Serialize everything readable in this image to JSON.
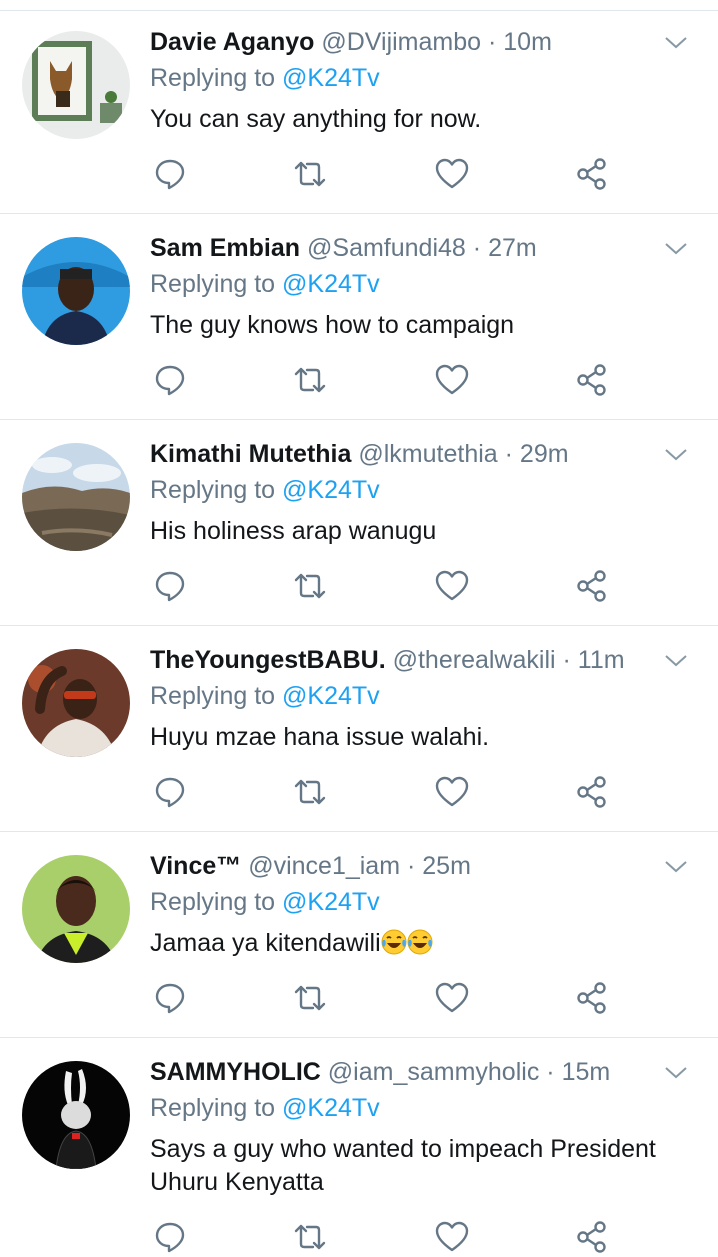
{
  "colors": {
    "name": "#14171a",
    "muted": "#657786",
    "link": "#1da1f2",
    "divider": "#e1e8ed"
  },
  "icons": [
    "reply-icon",
    "retweet-icon",
    "like-icon",
    "share-icon",
    "caret-down-icon"
  ],
  "tweets": [
    {
      "name": "Davie Aganyo",
      "handle": "@DVijimambo",
      "sep": "·",
      "time": "10m",
      "reply_prefix": "Replying to",
      "reply_to": "@K24Tv",
      "text": "You can say anything  for now."
    },
    {
      "name": "Sam Embian",
      "handle": "@Samfundi48",
      "sep": "·",
      "time": "27m",
      "reply_prefix": "Replying to",
      "reply_to": "@K24Tv",
      "text": "The guy knows how to campaign"
    },
    {
      "name": "Kimathi Mutethia",
      "handle": "@lkmutethia",
      "sep": "·",
      "time": "29m",
      "reply_prefix": "Replying to",
      "reply_to": "@K24Tv",
      "text": "His holiness arap wanugu"
    },
    {
      "name": "TheYoungestBABU.",
      "handle": "@therealwakili",
      "sep": "·",
      "time": "11m",
      "reply_prefix": "Replying to",
      "reply_to": "@K24Tv",
      "text": "Huyu mzae hana issue walahi."
    },
    {
      "name": "Vince™",
      "handle": "@vince1_iam",
      "sep": "·",
      "time": "25m",
      "reply_prefix": "Replying to",
      "reply_to": "@K24Tv",
      "text": "Jamaa ya kitendawili"
    },
    {
      "name": "SAMMYHOLIC",
      "handle": "@iam_sammyholic",
      "sep": "·",
      "time": "15m",
      "reply_prefix": "Replying to",
      "reply_to": "@K24Tv",
      "text": "Says a guy who wanted to impeach President Uhuru Kenyatta"
    }
  ]
}
